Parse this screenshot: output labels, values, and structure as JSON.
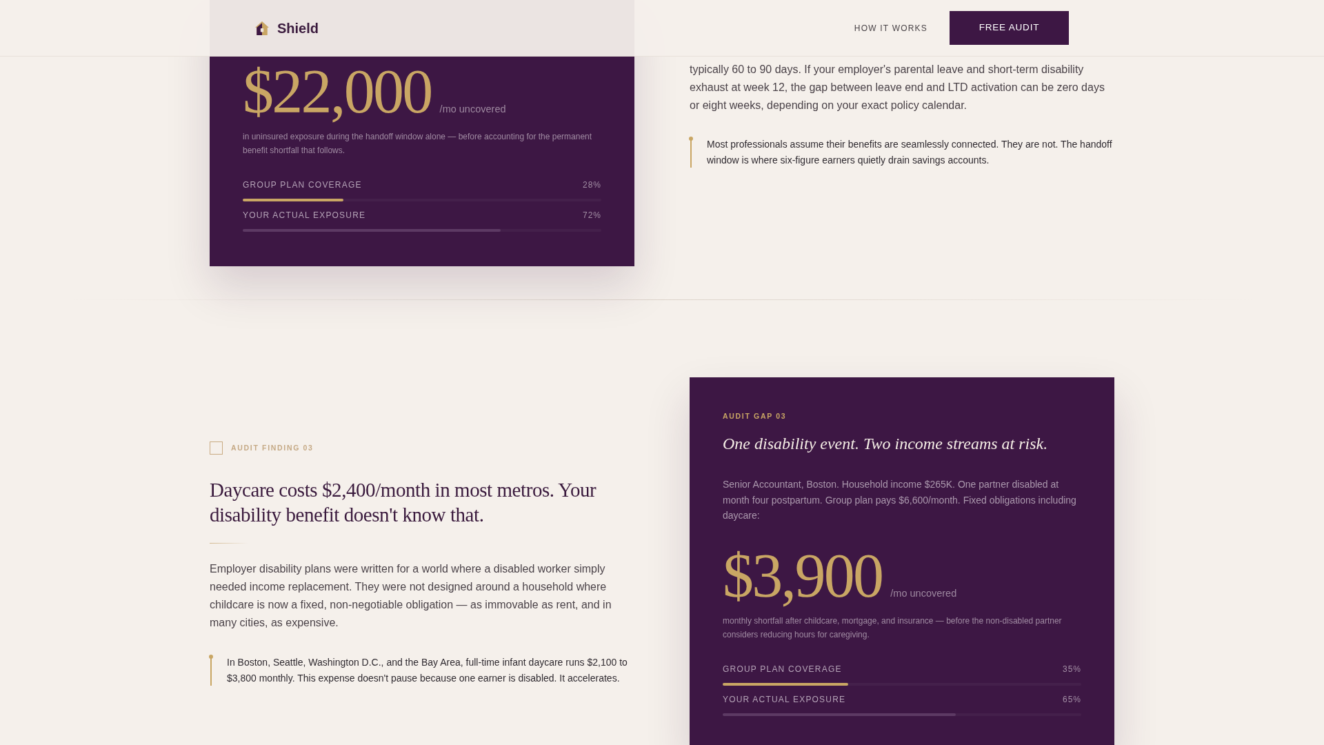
{
  "header": {
    "brand": "Shield",
    "nav_link": "HOW IT WORKS",
    "cta": "FREE AUDIT"
  },
  "top_section": {
    "card": {
      "amount": "$22,000",
      "unit": "/mo uncovered",
      "note": "in uninsured exposure during the handoff window alone — before accounting for the permanent benefit shortfall that follows.",
      "meters": [
        {
          "kind": "coverage",
          "label": "GROUP PLAN COVERAGE",
          "reading": "28%",
          "level": 0.28
        },
        {
          "kind": "exposure",
          "label": "YOUR ACTUAL EXPOSURE",
          "reading": "72%",
          "level": 0.72
        }
      ]
    },
    "body": "typically 60 to 90 days. If your employer's parental leave and short-term disability exhaust at week 12, the gap between leave end and LTD activation can be zero days or eight weeks, depending on your exact policy calendar.",
    "callout": "Most professionals assume their benefits are seamlessly connected. They are not. The handoff window is where six-figure earners quietly drain savings accounts."
  },
  "bottom_section": {
    "eyebrow": "AUDIT FINDING 03",
    "heading": "Daycare costs $2,400/month in most metros. Your disability benefit doesn't know that.",
    "body": "Employer disability plans were written for a world where a disabled worker simply needed income replacement. They were not designed around a household where childcare is now a fixed, non-negotiable obligation — as immovable as rent, and in many cities, as expensive.",
    "callout": "In Boston, Seattle, Washington D.C., and the Bay Area, full-time infant daycare runs $2,100 to $3,800 monthly. This expense doesn't pause because one earner is disabled. It accelerates.",
    "card": {
      "eyebrow": "AUDIT GAP 03",
      "title": "One disability event. Two income streams at risk.",
      "description": "Senior Accountant, Boston. Household income $265K. One partner disabled at month four postpartum. Group plan pays $6,600/month. Fixed obligations including daycare:",
      "amount": "$3,900",
      "unit": "/mo uncovered",
      "note": "monthly shortfall after childcare, mortgage, and insurance — before the non-disabled partner considers reducing hours for caregiving.",
      "meters": [
        {
          "kind": "coverage",
          "label": "GROUP PLAN COVERAGE",
          "reading": "35%",
          "level": 0.35
        },
        {
          "kind": "exposure",
          "label": "YOUR ACTUAL EXPOSURE",
          "reading": "65%",
          "level": 0.65
        }
      ]
    }
  }
}
